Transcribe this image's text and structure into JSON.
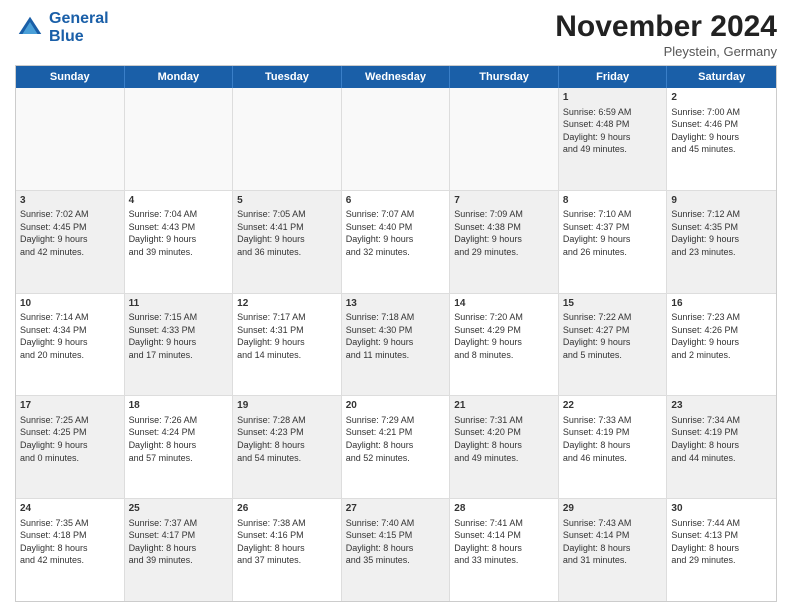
{
  "header": {
    "logo_line1": "General",
    "logo_line2": "Blue",
    "month": "November 2024",
    "location": "Pleystein, Germany"
  },
  "days_of_week": [
    "Sunday",
    "Monday",
    "Tuesday",
    "Wednesday",
    "Thursday",
    "Friday",
    "Saturday"
  ],
  "weeks": [
    [
      {
        "day": "",
        "info": "",
        "empty": true
      },
      {
        "day": "",
        "info": "",
        "empty": true
      },
      {
        "day": "",
        "info": "",
        "empty": true
      },
      {
        "day": "",
        "info": "",
        "empty": true
      },
      {
        "day": "",
        "info": "",
        "empty": true
      },
      {
        "day": "1",
        "info": "Sunrise: 6:59 AM\nSunset: 4:48 PM\nDaylight: 9 hours\nand 49 minutes.",
        "shaded": true
      },
      {
        "day": "2",
        "info": "Sunrise: 7:00 AM\nSunset: 4:46 PM\nDaylight: 9 hours\nand 45 minutes.",
        "shaded": false
      }
    ],
    [
      {
        "day": "3",
        "info": "Sunrise: 7:02 AM\nSunset: 4:45 PM\nDaylight: 9 hours\nand 42 minutes.",
        "shaded": true
      },
      {
        "day": "4",
        "info": "Sunrise: 7:04 AM\nSunset: 4:43 PM\nDaylight: 9 hours\nand 39 minutes.",
        "shaded": false
      },
      {
        "day": "5",
        "info": "Sunrise: 7:05 AM\nSunset: 4:41 PM\nDaylight: 9 hours\nand 36 minutes.",
        "shaded": true
      },
      {
        "day": "6",
        "info": "Sunrise: 7:07 AM\nSunset: 4:40 PM\nDaylight: 9 hours\nand 32 minutes.",
        "shaded": false
      },
      {
        "day": "7",
        "info": "Sunrise: 7:09 AM\nSunset: 4:38 PM\nDaylight: 9 hours\nand 29 minutes.",
        "shaded": true
      },
      {
        "day": "8",
        "info": "Sunrise: 7:10 AM\nSunset: 4:37 PM\nDaylight: 9 hours\nand 26 minutes.",
        "shaded": false
      },
      {
        "day": "9",
        "info": "Sunrise: 7:12 AM\nSunset: 4:35 PM\nDaylight: 9 hours\nand 23 minutes.",
        "shaded": true
      }
    ],
    [
      {
        "day": "10",
        "info": "Sunrise: 7:14 AM\nSunset: 4:34 PM\nDaylight: 9 hours\nand 20 minutes.",
        "shaded": false
      },
      {
        "day": "11",
        "info": "Sunrise: 7:15 AM\nSunset: 4:33 PM\nDaylight: 9 hours\nand 17 minutes.",
        "shaded": true
      },
      {
        "day": "12",
        "info": "Sunrise: 7:17 AM\nSunset: 4:31 PM\nDaylight: 9 hours\nand 14 minutes.",
        "shaded": false
      },
      {
        "day": "13",
        "info": "Sunrise: 7:18 AM\nSunset: 4:30 PM\nDaylight: 9 hours\nand 11 minutes.",
        "shaded": true
      },
      {
        "day": "14",
        "info": "Sunrise: 7:20 AM\nSunset: 4:29 PM\nDaylight: 9 hours\nand 8 minutes.",
        "shaded": false
      },
      {
        "day": "15",
        "info": "Sunrise: 7:22 AM\nSunset: 4:27 PM\nDaylight: 9 hours\nand 5 minutes.",
        "shaded": true
      },
      {
        "day": "16",
        "info": "Sunrise: 7:23 AM\nSunset: 4:26 PM\nDaylight: 9 hours\nand 2 minutes.",
        "shaded": false
      }
    ],
    [
      {
        "day": "17",
        "info": "Sunrise: 7:25 AM\nSunset: 4:25 PM\nDaylight: 9 hours\nand 0 minutes.",
        "shaded": true
      },
      {
        "day": "18",
        "info": "Sunrise: 7:26 AM\nSunset: 4:24 PM\nDaylight: 8 hours\nand 57 minutes.",
        "shaded": false
      },
      {
        "day": "19",
        "info": "Sunrise: 7:28 AM\nSunset: 4:23 PM\nDaylight: 8 hours\nand 54 minutes.",
        "shaded": true
      },
      {
        "day": "20",
        "info": "Sunrise: 7:29 AM\nSunset: 4:21 PM\nDaylight: 8 hours\nand 52 minutes.",
        "shaded": false
      },
      {
        "day": "21",
        "info": "Sunrise: 7:31 AM\nSunset: 4:20 PM\nDaylight: 8 hours\nand 49 minutes.",
        "shaded": true
      },
      {
        "day": "22",
        "info": "Sunrise: 7:33 AM\nSunset: 4:19 PM\nDaylight: 8 hours\nand 46 minutes.",
        "shaded": false
      },
      {
        "day": "23",
        "info": "Sunrise: 7:34 AM\nSunset: 4:19 PM\nDaylight: 8 hours\nand 44 minutes.",
        "shaded": true
      }
    ],
    [
      {
        "day": "24",
        "info": "Sunrise: 7:35 AM\nSunset: 4:18 PM\nDaylight: 8 hours\nand 42 minutes.",
        "shaded": false
      },
      {
        "day": "25",
        "info": "Sunrise: 7:37 AM\nSunset: 4:17 PM\nDaylight: 8 hours\nand 39 minutes.",
        "shaded": true
      },
      {
        "day": "26",
        "info": "Sunrise: 7:38 AM\nSunset: 4:16 PM\nDaylight: 8 hours\nand 37 minutes.",
        "shaded": false
      },
      {
        "day": "27",
        "info": "Sunrise: 7:40 AM\nSunset: 4:15 PM\nDaylight: 8 hours\nand 35 minutes.",
        "shaded": true
      },
      {
        "day": "28",
        "info": "Sunrise: 7:41 AM\nSunset: 4:14 PM\nDaylight: 8 hours\nand 33 minutes.",
        "shaded": false
      },
      {
        "day": "29",
        "info": "Sunrise: 7:43 AM\nSunset: 4:14 PM\nDaylight: 8 hours\nand 31 minutes.",
        "shaded": true
      },
      {
        "day": "30",
        "info": "Sunrise: 7:44 AM\nSunset: 4:13 PM\nDaylight: 8 hours\nand 29 minutes.",
        "shaded": false
      }
    ]
  ]
}
